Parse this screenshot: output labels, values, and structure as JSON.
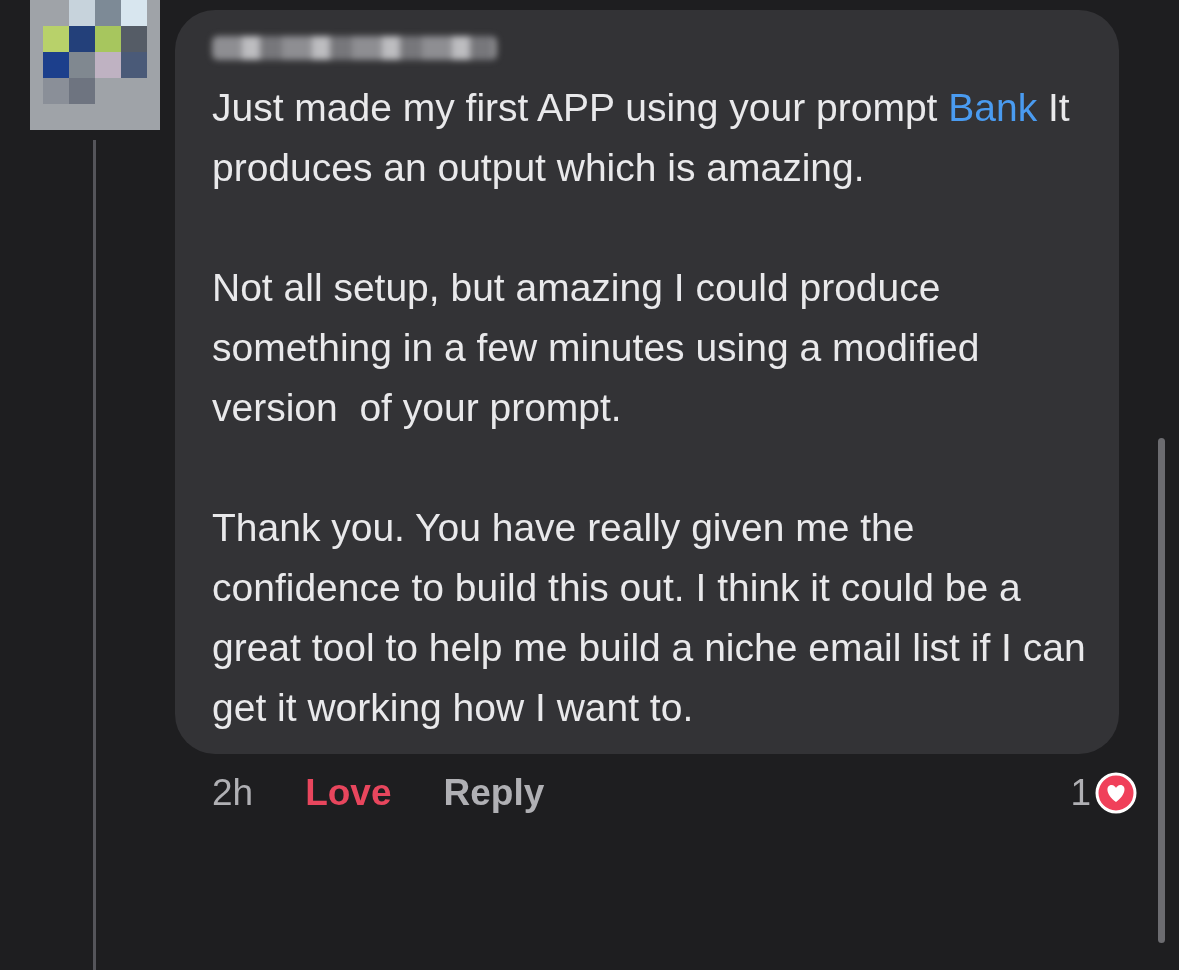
{
  "comment": {
    "paragraphs": [
      {
        "parts": [
          {
            "kind": "text",
            "text": "Just made my first APP using your prompt "
          },
          {
            "kind": "link",
            "text": "Bank"
          },
          {
            "kind": "text",
            "text": " It produces an output which is amazing."
          }
        ]
      },
      {
        "parts": [
          {
            "kind": "text",
            "text": "Not all setup, but amazing I could produce something in a few minutes using a modified version  of your prompt."
          }
        ]
      },
      {
        "parts": [
          {
            "kind": "text",
            "text": "Thank you. You have really given me the confidence to build this out. I think it could be a great tool to help me build a niche email list if I can get it working how I want to."
          }
        ]
      }
    ],
    "time": "2h",
    "reaction": {
      "label": "Love",
      "selected": true
    },
    "reply": "Reply",
    "reaction_count": "1"
  }
}
